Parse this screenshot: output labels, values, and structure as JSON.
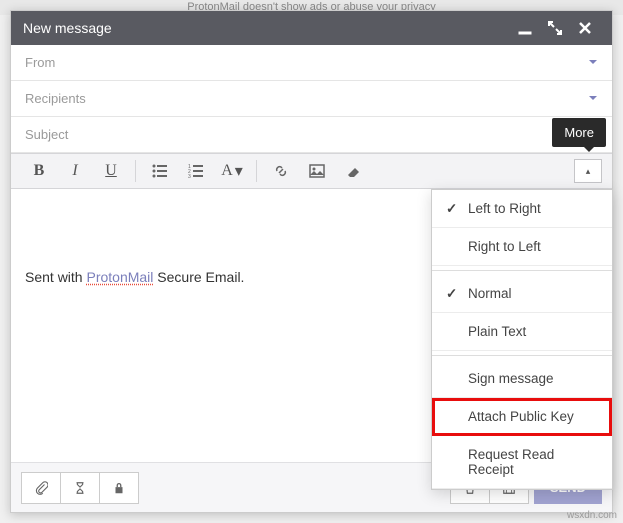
{
  "backdrop": {
    "text": "ProtonMail doesn't show ads or abuse your privacy"
  },
  "titlebar": {
    "title": "New message"
  },
  "fields": {
    "from": "From",
    "recipients": "Recipients",
    "subject": "Subject"
  },
  "toolbar": {
    "bold": "B",
    "italic": "I",
    "underline": "U",
    "font": "A",
    "more_tooltip": "More"
  },
  "body": {
    "prefix": "Sent with ",
    "link": "ProtonMail",
    "suffix": " Secure Email."
  },
  "dropdown": {
    "ltr": "Left to Right",
    "rtl": "Right to Left",
    "normal": "Normal",
    "plain": "Plain Text",
    "sign": "Sign message",
    "attach_key": "Attach Public Key",
    "read_receipt": "Request Read Receipt"
  },
  "footer": {
    "send": "SEND"
  },
  "watermark": "wsxdn.com"
}
